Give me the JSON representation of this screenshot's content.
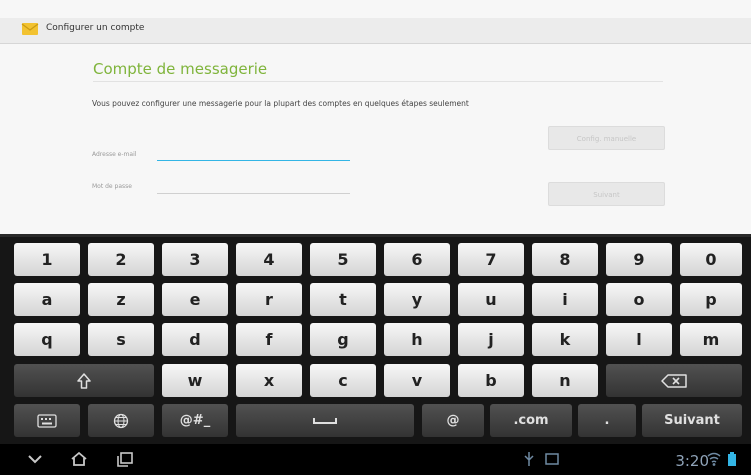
{
  "app": {
    "title": "Configurer un compte",
    "heading": "Compte de messagerie",
    "description": "Vous pouvez configurer une messagerie pour la plupart des comptes en quelques étapes seulement",
    "email_label": "Adresse e-mail",
    "email_value": "",
    "password_label": "Mot de passe",
    "password_value": "",
    "manual_setup_label": "Config. manuelle",
    "next_label": "Suivant",
    "accent_color": "#7fb43b",
    "focus_color": "#33b5e5"
  },
  "keyboard": {
    "row1": [
      "1",
      "2",
      "3",
      "4",
      "5",
      "6",
      "7",
      "8",
      "9",
      "0"
    ],
    "row2": [
      "a",
      "z",
      "e",
      "r",
      "t",
      "y",
      "u",
      "i",
      "o",
      "p"
    ],
    "row3": [
      "q",
      "s",
      "d",
      "f",
      "g",
      "h",
      "j",
      "k",
      "l",
      "m"
    ],
    "row4": [
      "w",
      "x",
      "c",
      "v",
      "b",
      "n"
    ],
    "symbols_label": "@#_",
    "at_label": "@",
    "com_label": ".com",
    "period_label": ".",
    "action_label": "Suivant",
    "icons": {
      "shift": "shift-icon",
      "backspace": "backspace-icon",
      "settings": "keyboard-settings-icon",
      "language": "globe-icon",
      "space": "space-bar-icon"
    }
  },
  "status_bar": {
    "time": "3:20",
    "icons": [
      "keyboard-hide-icon",
      "home-icon",
      "recent-apps-icon",
      "usb-icon",
      "screenshot-icon",
      "wifi-icon",
      "battery-icon"
    ]
  }
}
